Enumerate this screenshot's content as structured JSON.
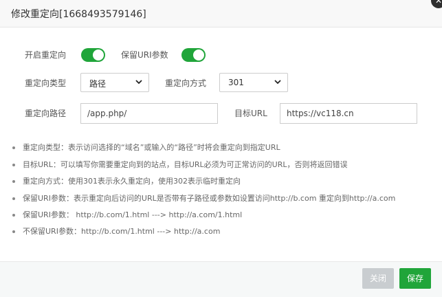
{
  "dialog": {
    "title": "修改重定向[1668493579146]",
    "close_icon": "close-icon"
  },
  "form": {
    "enable_redirect": {
      "label": "开启重定向",
      "on": true
    },
    "keep_uri": {
      "label": "保留URI参数",
      "on": true
    },
    "redirect_type": {
      "label": "重定向类型",
      "value": "路径"
    },
    "redirect_method": {
      "label": "重定向方式",
      "value": "301"
    },
    "redirect_path": {
      "label": "重定向路径",
      "value": "/app.php/"
    },
    "target_url": {
      "label": "目标URL",
      "value": "https://vc118.cn"
    }
  },
  "tips": [
    "重定向类型：表示访问选择的“域名”或输入的“路径”时将会重定向到指定URL",
    "目标URL：可以填写你需要重定向到的站点，目标URL必须为可正常访问的URL，否则将返回错误",
    "重定向方式：使用301表示永久重定向，使用302表示临时重定向",
    "保留URI参数：表示重定向后访问的URL是否带有子路径或参数如设置访问http://b.com 重定向到http://a.com",
    "保留URI参数：  http://b.com/1.html ---> http://a.com/1.html",
    "不保留URI参数：http://b.com/1.html ---> http://a.com"
  ],
  "footer": {
    "close_label": "关闭",
    "save_label": "保存"
  },
  "colors": {
    "accent": "#20a53a",
    "disabled": "#c9cdd0"
  }
}
